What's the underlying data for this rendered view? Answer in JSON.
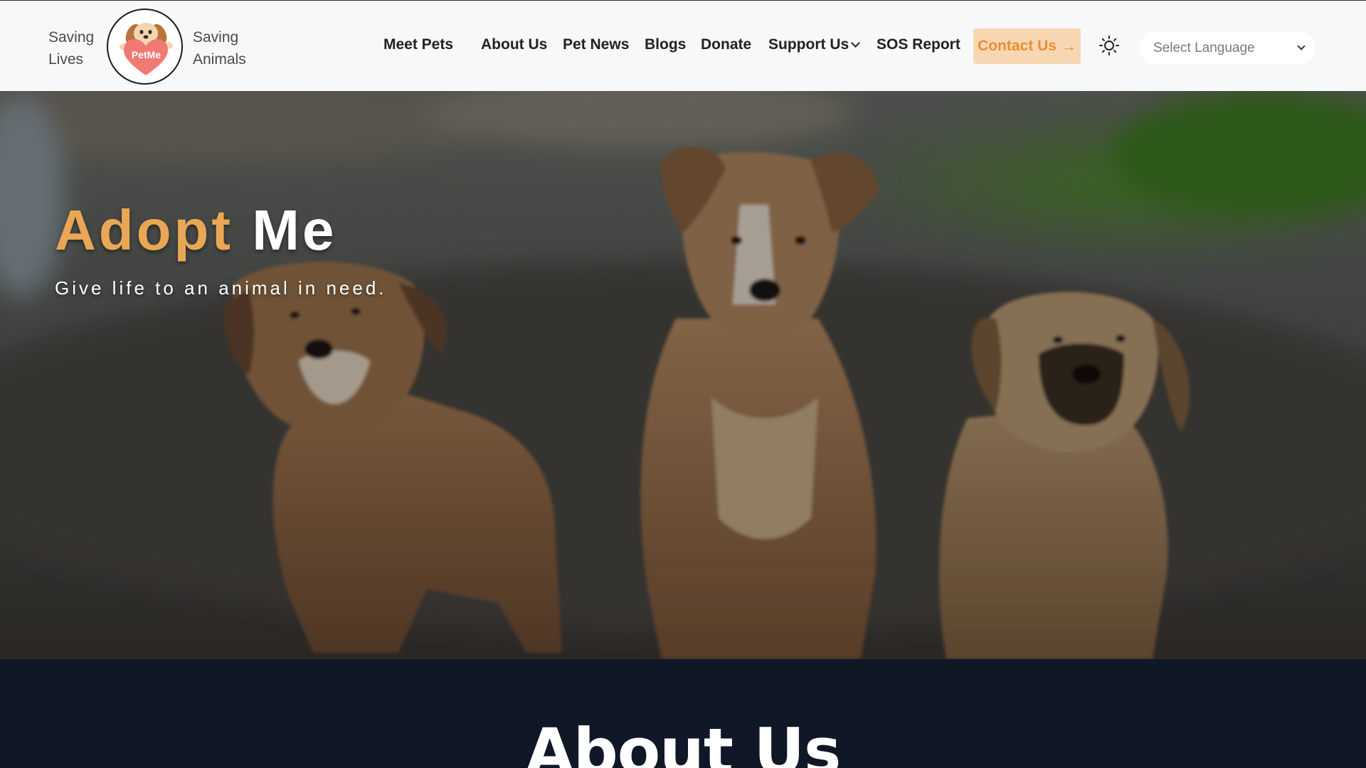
{
  "header": {
    "tagline_left": [
      "Saving",
      "Lives"
    ],
    "tagline_right": [
      "Saving",
      "Animals"
    ],
    "logo_text": "PetMe",
    "nav": [
      {
        "label": "Meet Pets"
      },
      {
        "label": "About Us"
      },
      {
        "label": "Pet News"
      },
      {
        "label": "Blogs"
      },
      {
        "label": "Donate"
      },
      {
        "label": "Support Us"
      },
      {
        "label": "SOS Report"
      }
    ],
    "contact_label": "Contact Us",
    "contact_icon": "arrow-right-icon",
    "theme_icon": "sun-icon",
    "language": {
      "placeholder": "Select Language"
    }
  },
  "hero": {
    "title_word1": "Adopt",
    "title_word2": "Me",
    "subtitle": "Give life to an animal in need."
  },
  "about": {
    "title": "About Us"
  },
  "colors": {
    "accent": "#e9a755",
    "contact_bg": "#f7d7b3",
    "contact_text": "#ec8d32",
    "dark_section": "#101828",
    "header_bg": "#f7f8fa"
  }
}
